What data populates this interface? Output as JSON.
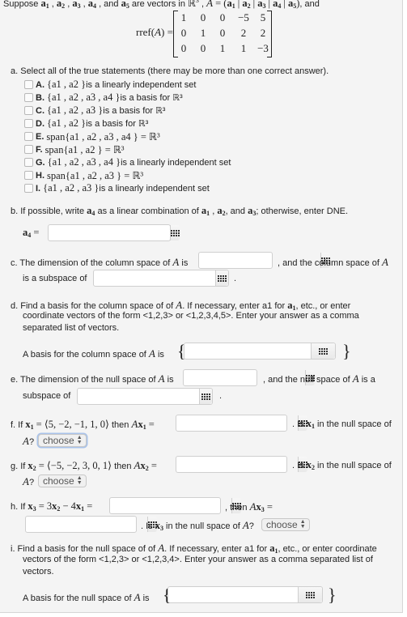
{
  "intro": {
    "text_suppose": "Suppose",
    "vectors": [
      "a1",
      "a2",
      "a3",
      "a4",
      "a5"
    ],
    "text_are_vectors_in": "are vectors in",
    "space": "ℝ",
    "space_dim": "3",
    "A_def": "A = (a1 | a2 | a3 | a4 | a5), and"
  },
  "rref": {
    "label": "rref(A) =",
    "rows": [
      [
        "1",
        "0",
        "0",
        "−5",
        "5"
      ],
      [
        "0",
        "1",
        "0",
        "2",
        "2"
      ],
      [
        "0",
        "0",
        "1",
        "1",
        "−3"
      ]
    ]
  },
  "part_a": {
    "prompt": "a.  Select all of the true statements (there may be more than one correct answer).",
    "options": [
      {
        "letter": "A.",
        "math": "{a1 , a2 }",
        "text": " is a linearly independent set",
        "checked": false
      },
      {
        "letter": "B.",
        "math": "{a1 , a2 , a3 , a4 }",
        "text": " is a basis for ℝ³",
        "checked": false
      },
      {
        "letter": "C.",
        "math": "{a1 , a2 , a3 }",
        "text": " is a basis for ℝ³",
        "checked": false
      },
      {
        "letter": "D.",
        "math": "{a1 , a2 }",
        "text": " is a basis for ℝ³",
        "checked": false
      },
      {
        "letter": "E.",
        "math": "span{a1 , a2 , a3 , a4 } = ℝ³",
        "text": "",
        "checked": false
      },
      {
        "letter": "F.",
        "math": "span{a1 , a2 } = ℝ³",
        "text": "",
        "checked": false
      },
      {
        "letter": "G.",
        "math": "{a1 , a2 , a3 , a4 }",
        "text": " is a linearly independent set",
        "checked": false
      },
      {
        "letter": "H.",
        "math": "span{a1 , a2 , a3 } = ℝ³",
        "text": "",
        "checked": false
      },
      {
        "letter": "I.",
        "math": "{a1 , a2 , a3 }",
        "text": " is a linearly independent set",
        "checked": false
      }
    ]
  },
  "part_b": {
    "prompt_1": "b.  If possible, write",
    "prompt_2": "as a linear combination of",
    "prompt_3": ", and",
    "prompt_4": "; otherwise, enter DNE.",
    "label": "a4 =",
    "value": ""
  },
  "part_c": {
    "text_1": "c.  The dimension of the column space of",
    "text_2": "is",
    "text_3": ", and the column space of",
    "text_4": "is a subspace of",
    "text_5": ".",
    "value_dim": "",
    "value_subspace": ""
  },
  "part_d": {
    "line1a": "d.  Find a basis for the column space of of",
    "line1b": ". If necessary, enter a1 for",
    "line1c": ", etc., or enter",
    "line2": "coordinate vectors of the form <1,2,3> or <1,2,3,4,5>. Enter your answer as a comma",
    "line3": "separated list of vectors.",
    "label": "A basis for the column space of",
    "label_is": "is",
    "value": ""
  },
  "part_e": {
    "text_1": "e.  The dimension of the null space of",
    "text_2": "is",
    "text_3": ", and the null space of",
    "text_4": "is a",
    "text_5": "subspace of",
    "text_6": ".",
    "value_dim": "",
    "value_subspace": ""
  },
  "part_f": {
    "text_1": "f.  If",
    "x_def": "x1 = ⟨5, −2, −1, 1, 0⟩",
    "text_2": "then",
    "Ax": "Ax1 =",
    "text_3": ". Is",
    "text_4": "in the null space of",
    "text_5": "A?",
    "value": "",
    "select": "choose"
  },
  "part_g": {
    "text_1": "g.  If",
    "x_def": "x2 = ⟨−5, −2, 3, 0, 1⟩",
    "text_2": "then",
    "Ax": "Ax2 =",
    "text_3": ". Is",
    "text_4": "in the null space of",
    "text_5": "A?",
    "value": "",
    "select": "choose"
  },
  "part_h": {
    "text_1": "h.  If",
    "x_def": "x3 = 3x2 − 4x1 =",
    "text_2": ", then",
    "Ax": "Ax3 =",
    "text_3": ". Is",
    "text_4": "in the null space of",
    "text_5": "A?",
    "value_x3": "",
    "value_Ax3": "",
    "select": "choose"
  },
  "part_i": {
    "line1a": "i.  Find a basis for the null space of of",
    "line1b": ". If necessary, enter a1 for",
    "line1c": ", etc., or enter coordinate",
    "line2": "vectors of the form <1,2,3> or <1,2,3,4>. Enter your answer as a comma separated list of",
    "line3": "vectors.",
    "label": "A basis for the null space of",
    "label_is": "is",
    "value": ""
  }
}
